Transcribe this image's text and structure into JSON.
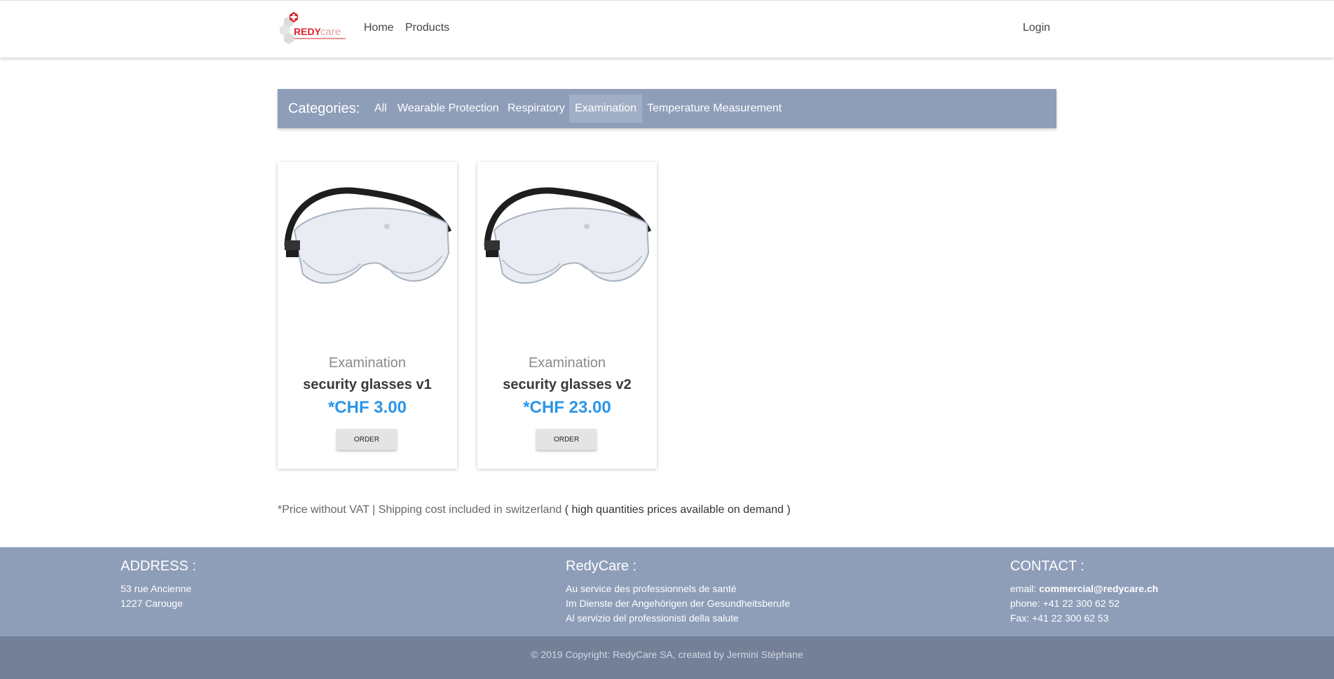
{
  "nav": {
    "logo_text_1": "REDY",
    "logo_text_2": "care",
    "home": "Home",
    "products": "Products",
    "login": "Login"
  },
  "categories": {
    "title": "Categories:",
    "items": [
      "All",
      "Wearable Protection",
      "Respiratory",
      "Examination",
      "Temperature Measurement"
    ],
    "active": "Examination"
  },
  "products": [
    {
      "category": "Examination",
      "name": "security glasses v1",
      "price": "*CHF 3.00",
      "button": "ORDER",
      "icon": "safety-goggles-image"
    },
    {
      "category": "Examination",
      "name": "security glasses v2",
      "price": "*CHF 23.00",
      "button": "ORDER",
      "icon": "safety-goggles-image"
    }
  ],
  "note": {
    "light": "*Price without VAT | Shipping cost included in switzerland",
    "dark": " ( high quantities prices available on demand )"
  },
  "footer": {
    "address": {
      "title": "ADDRESS :",
      "lines": [
        "53 rue Ancienne",
        "1227 Carouge"
      ]
    },
    "company": {
      "title": "RedyCare :",
      "lines": [
        "Au service des professionnels de santé",
        "Im Dienste der Angehörigen der Gesundheitsberufe",
        "Al servizio del professionisti della salute"
      ]
    },
    "contact": {
      "title": "CONTACT :",
      "email_label": "email: ",
      "email": "commercial@redycare.ch",
      "phone": "phone: +41 22 300 62 52",
      "fax": "Fax: +41 22 300 62 53"
    },
    "copyright": "© 2019 Copyright: RedyCare SA, created by Jermini Stéphane"
  },
  "colors": {
    "accent_bar": "#8e9eb9",
    "price": "#2b95e8",
    "logo_red": "#d8232a"
  }
}
